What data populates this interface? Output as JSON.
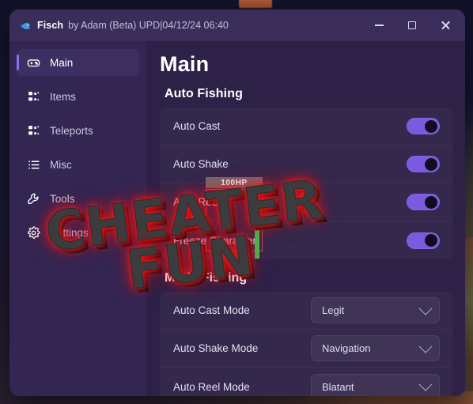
{
  "window": {
    "app_name": "Fisch",
    "subtitle": "by Adam (Beta) UPD|04/12/24 06:40",
    "icon": "fish-icon",
    "controls": {
      "minimize_label": "Minimize",
      "maximize_label": "Maximize",
      "close_label": "Close"
    }
  },
  "sidebar": {
    "items": [
      {
        "label": "Main",
        "icon": "gamepad-icon",
        "active": true
      },
      {
        "label": "Items",
        "icon": "blocks-icon",
        "active": false
      },
      {
        "label": "Teleports",
        "icon": "blocks-icon",
        "active": false
      },
      {
        "label": "Misc",
        "icon": "list-icon",
        "active": false
      },
      {
        "label": "Tools",
        "icon": "wrench-icon",
        "active": false
      },
      {
        "label": "Settings",
        "icon": "gear-icon",
        "active": false
      }
    ]
  },
  "main": {
    "page_title": "Main",
    "sections": [
      {
        "title": "Auto Fishing",
        "rows": [
          {
            "label": "Auto Cast",
            "control": "toggle",
            "value": "on"
          },
          {
            "label": "Auto Shake",
            "control": "toggle",
            "value": "on"
          },
          {
            "label": "Auto Reel",
            "control": "toggle",
            "value": "on"
          },
          {
            "label": "Freeze Character",
            "control": "toggle",
            "value": "on"
          }
        ]
      },
      {
        "title": "Mode Fishing",
        "rows": [
          {
            "label": "Auto Cast Mode",
            "control": "dropdown",
            "value": "Legit"
          },
          {
            "label": "Auto Shake Mode",
            "control": "dropdown",
            "value": "Navigation"
          },
          {
            "label": "Auto Reel Mode",
            "control": "dropdown",
            "value": "Blatant"
          }
        ]
      }
    ]
  },
  "overlay": {
    "hp_label": "100HP",
    "esp_box_color": "#e25454",
    "hp_bar_color": "#3fc452"
  },
  "watermark": {
    "line1": "CHEATER",
    "line2": "FUN",
    "glow_color": "#ff1414"
  },
  "theme": {
    "accent": "#8b6ff0",
    "toggle_on": "#7a5ae0",
    "window_bg": "#2d2147",
    "sidebar_bg": "#332653",
    "titlebar_bg": "#3a2d59"
  }
}
